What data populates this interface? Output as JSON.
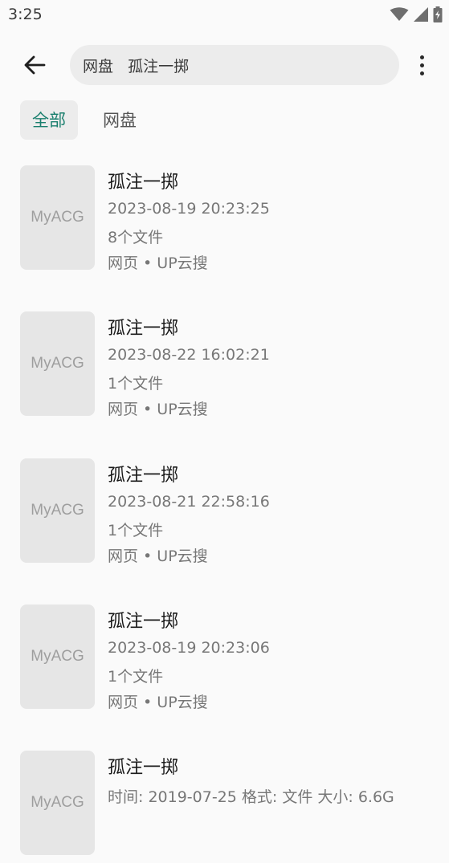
{
  "status_bar": {
    "time": "3:25",
    "icons": [
      "wifi-icon",
      "signal-icon",
      "battery-charging-icon"
    ]
  },
  "top_bar": {
    "back_icon": "arrow-left-icon",
    "search_query": "网盘   孤注一掷",
    "more_icon": "more-vertical-icon"
  },
  "tabs": [
    {
      "label": "全部",
      "active": true
    },
    {
      "label": "网盘",
      "active": false
    }
  ],
  "results": [
    {
      "thumb": "MyACG",
      "title": "孤注一掷",
      "date": "2023-08-19 20:23:25",
      "files": "8个文件",
      "source": "网页 • UP云搜"
    },
    {
      "thumb": "MyACG",
      "title": "孤注一掷",
      "date": "2023-08-22 16:02:21",
      "files": "1个文件",
      "source": "网页 • UP云搜"
    },
    {
      "thumb": "MyACG",
      "title": "孤注一掷",
      "date": "2023-08-21 22:58:16",
      "files": "1个文件",
      "source": "网页 • UP云搜"
    },
    {
      "thumb": "MyACG",
      "title": "孤注一掷",
      "date": "2023-08-19 20:23:06",
      "files": "1个文件",
      "source": "网页 • UP云搜"
    },
    {
      "thumb": "MyACG",
      "title": "孤注一掷",
      "date": "时间: 2019-07-25 格式: 文件 大小: 6.6G",
      "files": "",
      "source": ""
    }
  ]
}
